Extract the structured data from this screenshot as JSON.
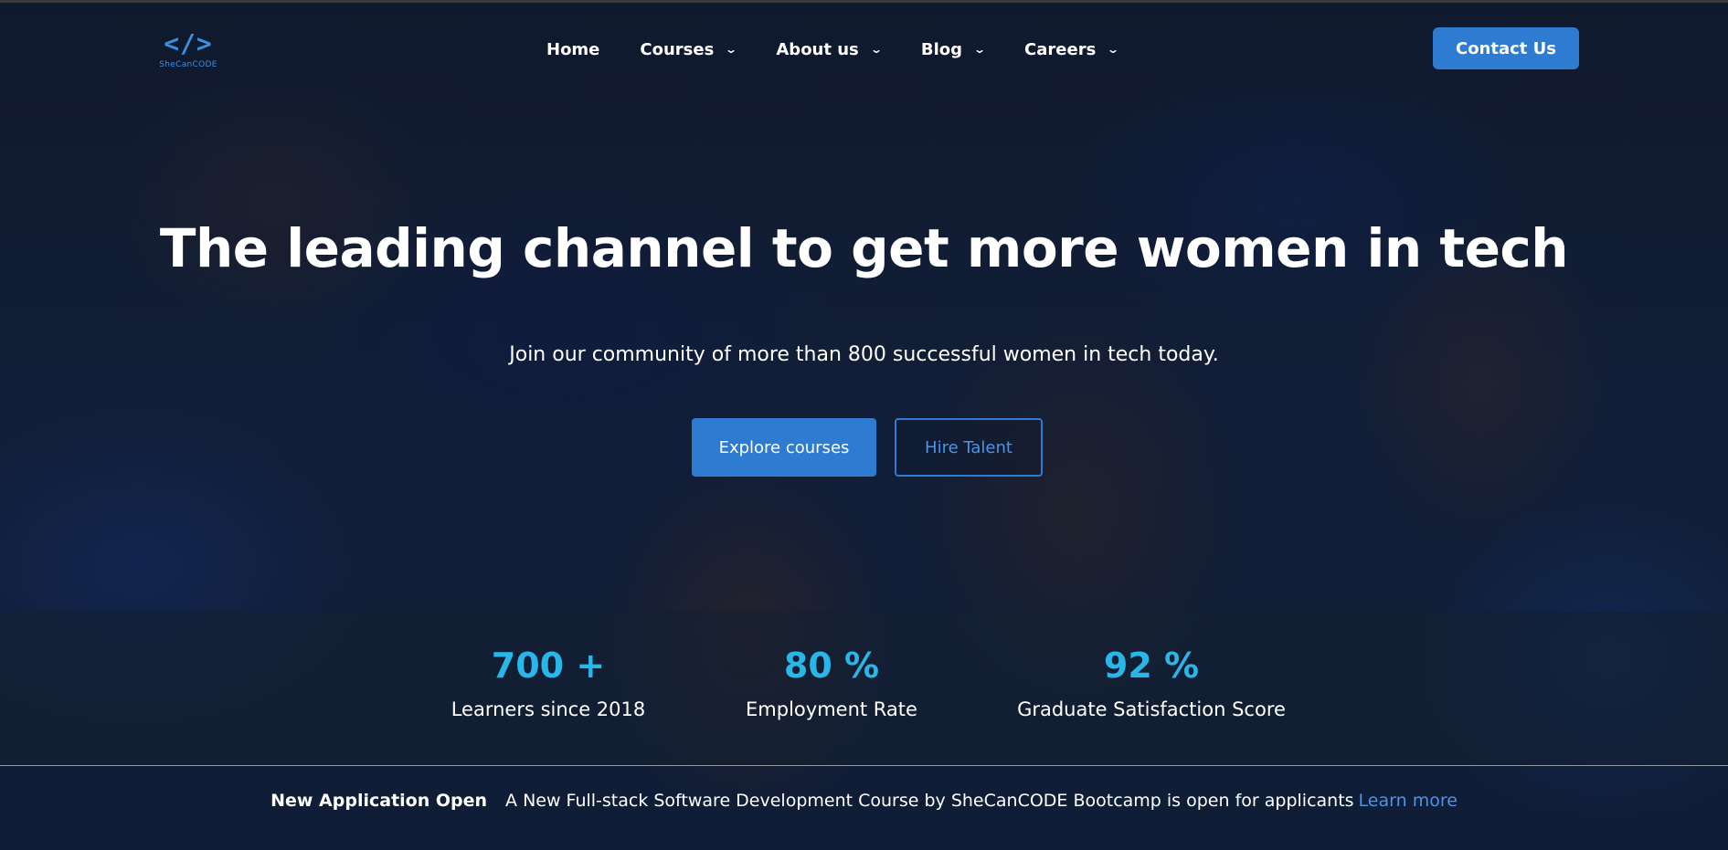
{
  "header": {
    "logo": {
      "glyph": "</>",
      "text": "SheCanCODE"
    },
    "nav": [
      {
        "label": "Home",
        "has_dropdown": false
      },
      {
        "label": "Courses",
        "has_dropdown": true
      },
      {
        "label": "About us",
        "has_dropdown": true
      },
      {
        "label": "Blog",
        "has_dropdown": true
      },
      {
        "label": "Careers",
        "has_dropdown": true
      }
    ],
    "contact_label": "Contact Us"
  },
  "hero": {
    "title": "The leading channel to get more women in tech",
    "subtitle": "Join our community of more than 800 successful women in tech today.",
    "primary_button": "Explore courses",
    "secondary_button": "Hire Talent"
  },
  "stats": [
    {
      "value": "700 +",
      "label": "Learners since 2018"
    },
    {
      "value": "80 %",
      "label": "Employment Rate"
    },
    {
      "value": "92 %",
      "label": "Graduate Satisfaction Score"
    }
  ],
  "announcement": {
    "tag": "New Application Open",
    "text": "A New Full-stack Software Development Course by SheCanCODE Bootcamp is open for applicants",
    "link": "Learn more"
  },
  "icons": {
    "dropdown": "chevron-down-icon"
  },
  "colors": {
    "accent": "#2e7bd2",
    "stat": "#29b6e8",
    "link": "#4d93e6"
  }
}
